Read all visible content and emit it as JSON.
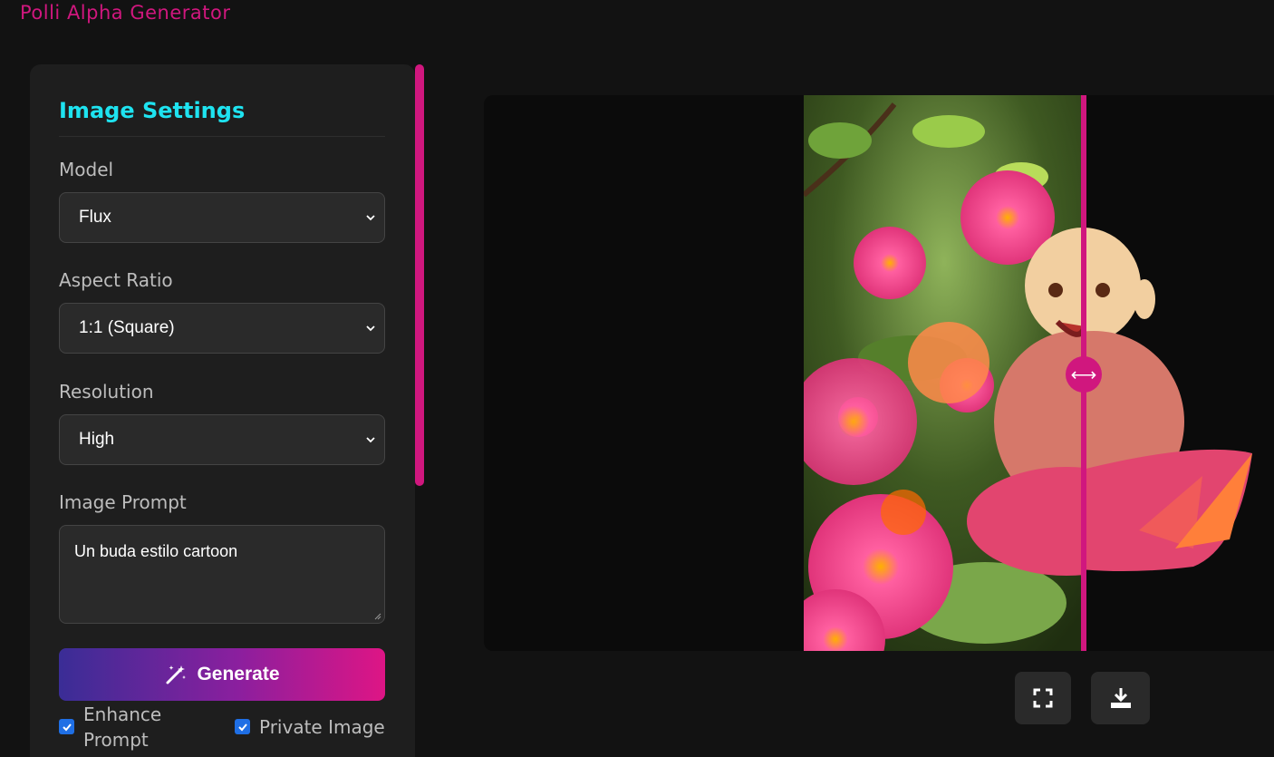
{
  "app": {
    "title": "Polli Alpha Generator"
  },
  "settings": {
    "heading": "Image Settings",
    "model": {
      "label": "Model",
      "value": "Flux"
    },
    "aspect_ratio": {
      "label": "Aspect Ratio",
      "value": "1:1 (Square)"
    },
    "resolution": {
      "label": "Resolution",
      "value": "High"
    },
    "prompt": {
      "label": "Image Prompt",
      "value": "Un buda estilo cartoon"
    },
    "generate_label": "Generate",
    "enhance_prompt": {
      "label_line1": "Enhance",
      "label_line2": "Prompt",
      "checked": true
    },
    "private_image": {
      "label": "Private Image",
      "checked": true
    }
  },
  "preview": {
    "comparison_handle_glyph": "⟷",
    "actions": [
      "fullscreen-icon",
      "download-icon"
    ]
  },
  "colors": {
    "accent": "#d0177e",
    "heading": "#1ee3f0",
    "checkbox": "#1f6fe5"
  }
}
